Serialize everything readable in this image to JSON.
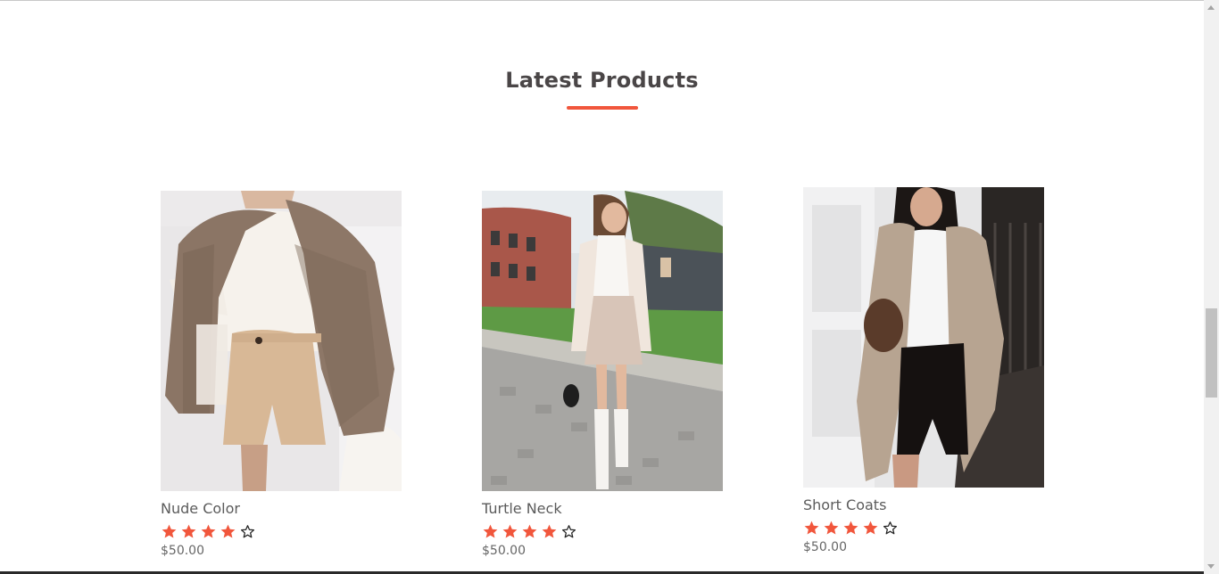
{
  "section": {
    "title": "Latest Products",
    "accent_color": "#f1563c"
  },
  "products": [
    {
      "name": "Nude Color",
      "rating": 4,
      "max_rating": 5,
      "price": "$50.00",
      "image_icon": "product-photo-plaid-blazer-shorts"
    },
    {
      "name": "Turtle Neck",
      "rating": 4,
      "max_rating": 5,
      "price": "$50.00",
      "image_icon": "product-photo-turtleneck-skirt"
    },
    {
      "name": "Short Coats",
      "rating": 4,
      "max_rating": 5,
      "price": "$50.00",
      "image_icon": "product-photo-beige-coat"
    }
  ],
  "colors": {
    "star_filled": "#f1563c",
    "star_empty_outline": "#222222",
    "title_text": "#4a4647"
  }
}
